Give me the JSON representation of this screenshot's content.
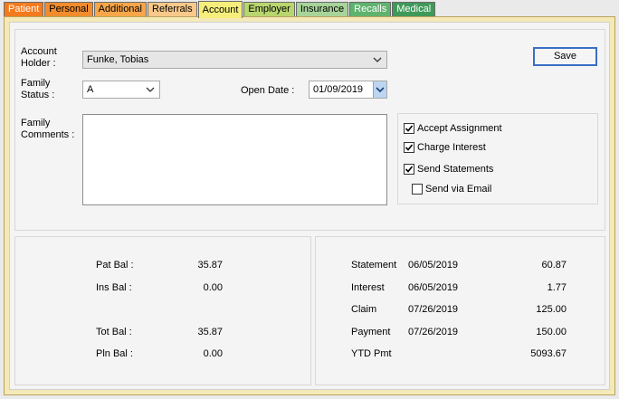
{
  "tabs": [
    {
      "label": "Patient",
      "bg": "#f47a1e",
      "fg": "#ffffff"
    },
    {
      "label": "Personal",
      "bg": "#f28c2c",
      "fg": "#000000"
    },
    {
      "label": "Additional",
      "bg": "#f7a64a",
      "fg": "#000000"
    },
    {
      "label": "Referrals",
      "bg": "#f8c98a",
      "fg": "#000000"
    },
    {
      "label": "Account",
      "bg": "#f6ee7a",
      "fg": "#000000",
      "active": true
    },
    {
      "label": "Employer",
      "bg": "#b9d66e",
      "fg": "#000000"
    },
    {
      "label": "Insurance",
      "bg": "#a8d49a",
      "fg": "#000000"
    },
    {
      "label": "Recalls",
      "bg": "#5fb36e",
      "fg": "#ffffff"
    },
    {
      "label": "Medical",
      "bg": "#3f9a5a",
      "fg": "#ffffff"
    }
  ],
  "form": {
    "account_holder_label_1": "Account",
    "account_holder_label_2": "Holder :",
    "account_holder_value": "Funke, Tobias",
    "family_status_label_1": "Family",
    "family_status_label_2": "Status :",
    "family_status_value": "A",
    "open_date_label": "Open  Date :",
    "open_date_value": "01/09/2019",
    "family_comments_label_1": "Family",
    "family_comments_label_2": "Comments :",
    "family_comments_value": "",
    "save_label": "Save"
  },
  "checkboxes": {
    "accept_assignment": {
      "label": "Accept Assignment",
      "checked": true
    },
    "charge_interest": {
      "label": "Charge Interest",
      "checked": true
    },
    "send_statements": {
      "label": "Send Statements",
      "checked": true
    },
    "send_via_email": {
      "label": "Send via Email",
      "checked": false
    }
  },
  "balances": [
    {
      "label": "Pat Bal :",
      "value": "35.87"
    },
    {
      "label": "Ins Bal :",
      "value": "0.00"
    },
    {
      "label": "Tot Bal :",
      "value": "35.87"
    },
    {
      "label": "Pln Bal :",
      "value": "0.00"
    }
  ],
  "activity": [
    {
      "label": "Statement",
      "date": "06/05/2019",
      "amount": "60.87"
    },
    {
      "label": "Interest",
      "date": "06/05/2019",
      "amount": "1.77"
    },
    {
      "label": "Claim",
      "date": "07/26/2019",
      "amount": "125.00"
    },
    {
      "label": "Payment",
      "date": "07/26/2019",
      "amount": "150.00"
    },
    {
      "label": "YTD Pmt",
      "date": "",
      "amount": "5093.67"
    }
  ]
}
